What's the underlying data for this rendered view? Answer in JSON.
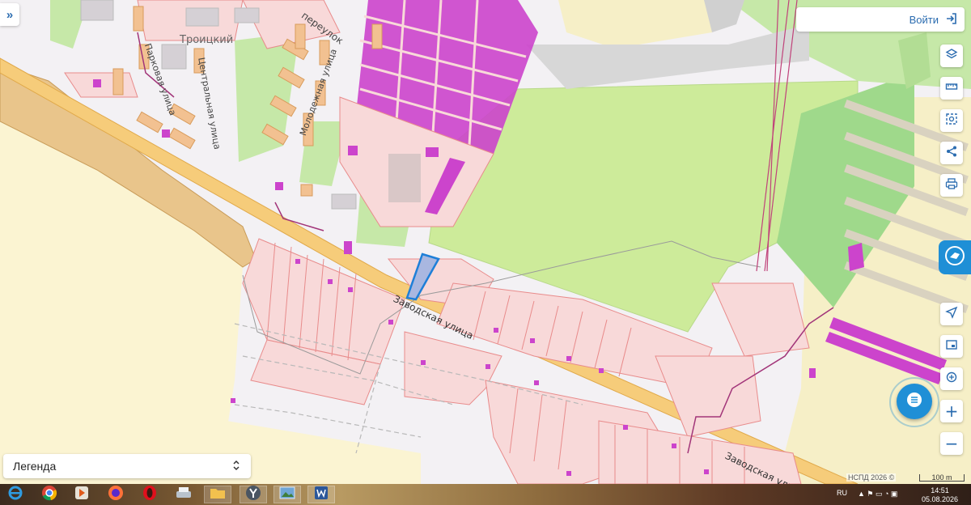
{
  "map": {
    "labels": {
      "town": "Троицкий",
      "street_pereulok": "переулок",
      "street_parkovaya": "Парковая улица",
      "street_tsentralnaya": "Центральная улица",
      "street_molodezhnaya": "Молодежная улица",
      "street_zavodskaya_main": "Заводская улица",
      "street_zavodskaya_second": "Заводская улица"
    },
    "colors": {
      "background": "#f3f1f4",
      "field": "#fbf4d2",
      "green_park": "#c6e8a8",
      "green_field": "#cdeb9a",
      "parcel_fill": "#f8d9d9",
      "parcel_stroke": "#e88b8b",
      "building_magenta": "#cc44cc",
      "building_orange": "#f2c191",
      "road": "#f6cc7a",
      "selected_parcel": "#1e7fd8",
      "brown_area": "#e9c58b"
    }
  },
  "ui": {
    "expand_icon": "double-chevron-right-icon",
    "login_label": "Войти",
    "login_icon": "login-icon",
    "legend_label": "Легенда",
    "legend_icon": "chevron-up-down-icon",
    "tools": [
      "layers-icon",
      "ruler-icon",
      "select-area-icon",
      "share-icon",
      "print-icon"
    ],
    "nav_tools": [
      "navigate-icon",
      "window-icon",
      "location-icon",
      "zoom-in-icon",
      "zoom-out-icon"
    ],
    "zoom_in": "+",
    "zoom_out": "−",
    "attribution": "НСПД 2026 ©",
    "scale_label": "100 m"
  },
  "taskbar": {
    "apps": [
      "ie-icon",
      "chrome-icon",
      "media-player-icon",
      "firefox-icon",
      "opera-icon",
      "scanner-icon",
      "explorer-icon",
      "yandex-icon",
      "photos-icon",
      "word-icon"
    ],
    "language": "RU",
    "time": "14:51",
    "date": "05.08.2026"
  }
}
